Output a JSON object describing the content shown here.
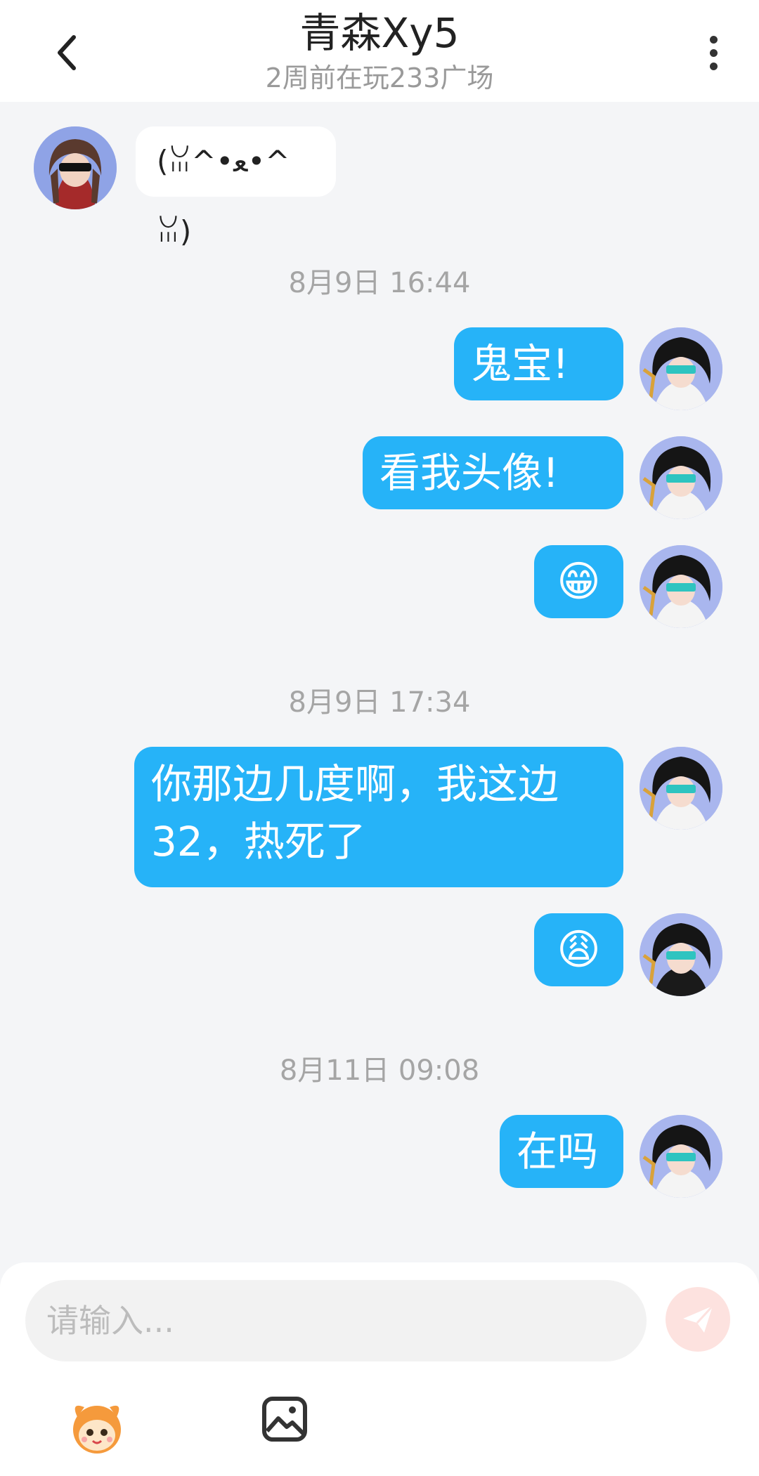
{
  "header": {
    "title": "青森Xy5",
    "status": "2周前在玩233广场"
  },
  "messages": {
    "m0": "(ꈍ^•ﻌ•^ꈍ)",
    "t1": "8月9日 16:44",
    "m1": "鬼宝!",
    "m2": "看我头像!",
    "m3": "😁",
    "t2": "8月9日 17:34",
    "m4_line1": "你那边几度啊，我这边",
    "m4_line2": "32，热死了",
    "m5": "😩",
    "t3": "8月11日 09:08",
    "m6": "在吗"
  },
  "composer": {
    "placeholder": "请输入..."
  },
  "icons": {
    "back": "chevron-left-icon",
    "more": "more-vertical-icon",
    "send": "send-icon",
    "mascot": "mascot-sticker-icon",
    "image": "image-icon"
  },
  "colors": {
    "bubble_out": "#26b3f8",
    "bubble_in": "#ffffff",
    "background": "#f4f5f7",
    "send_disabled": "#fde2df"
  }
}
